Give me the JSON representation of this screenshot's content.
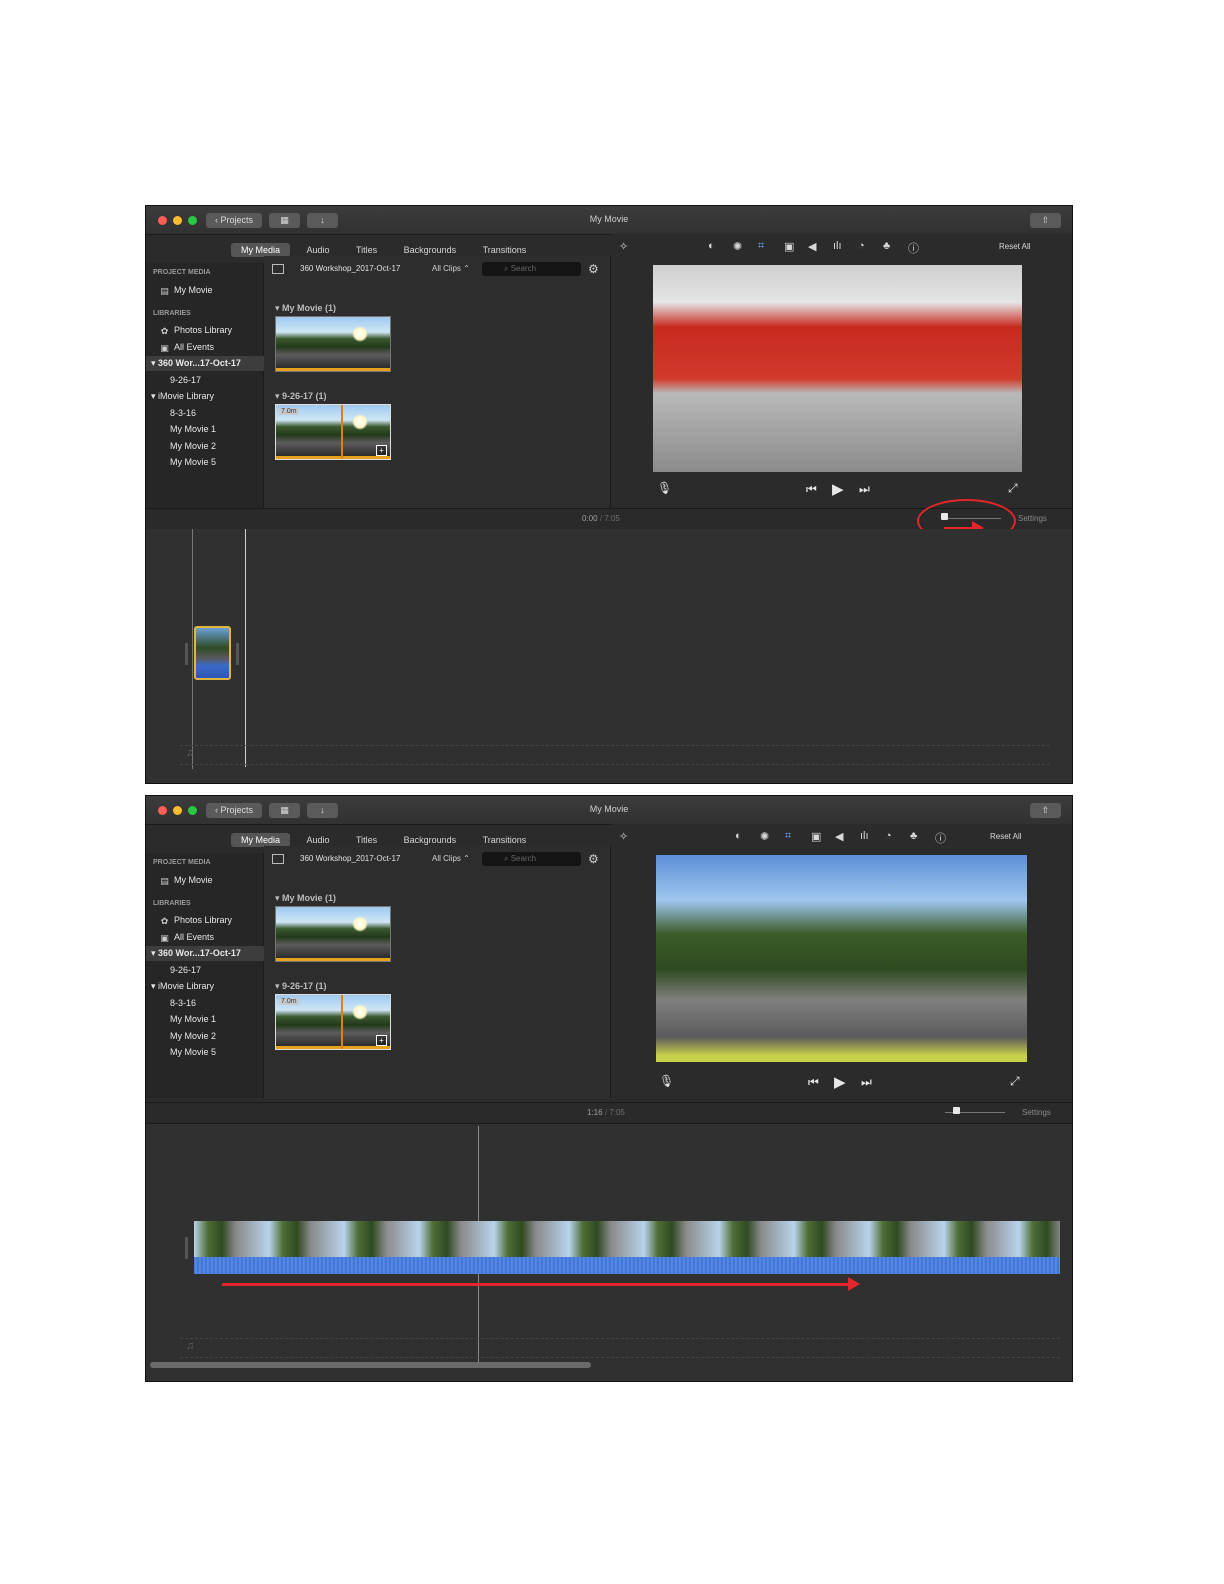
{
  "window": {
    "title": "My Movie",
    "projects_label": "Projects"
  },
  "browser_tabs": [
    "My Media",
    "Audio",
    "Titles",
    "Backgrounds",
    "Transitions"
  ],
  "sidebar": {
    "project_media_header": "PROJECT MEDIA",
    "project_item": "My Movie",
    "libraries_header": "LIBRARIES",
    "photos_library": "Photos Library",
    "all_events": "All Events",
    "selected_library": "360 Wor...17-Oct-17",
    "selected_library_child": "9-26-17",
    "imovie_library": "iMovie Library",
    "imovie_items": [
      "8-3-16",
      "My Movie 1",
      "My Movie 2",
      "My Movie 5"
    ]
  },
  "media_browser": {
    "library_name": "360 Workshop_2017-Oct-17",
    "clip_filter": "All Clips",
    "search_placeholder": "Search",
    "event_1_title": "My Movie   (1)",
    "event_2_title": "9-26-17   (1)",
    "clip_duration_badge": "7.0m"
  },
  "viewer": {
    "reset_all": "Reset All"
  },
  "screens": [
    {
      "timecode_current": "0:00",
      "timecode_total": "7:05",
      "zoom_level": 0.05
    },
    {
      "timecode_current": "1:16",
      "timecode_total": "7:05",
      "zoom_level": 0.2
    }
  ],
  "timeline": {
    "settings_label": "Settings"
  },
  "colors": {
    "annotation": "#e3262a",
    "clip_selected_border": "#e0b63c",
    "audio_waveform": "#3f74d8"
  }
}
